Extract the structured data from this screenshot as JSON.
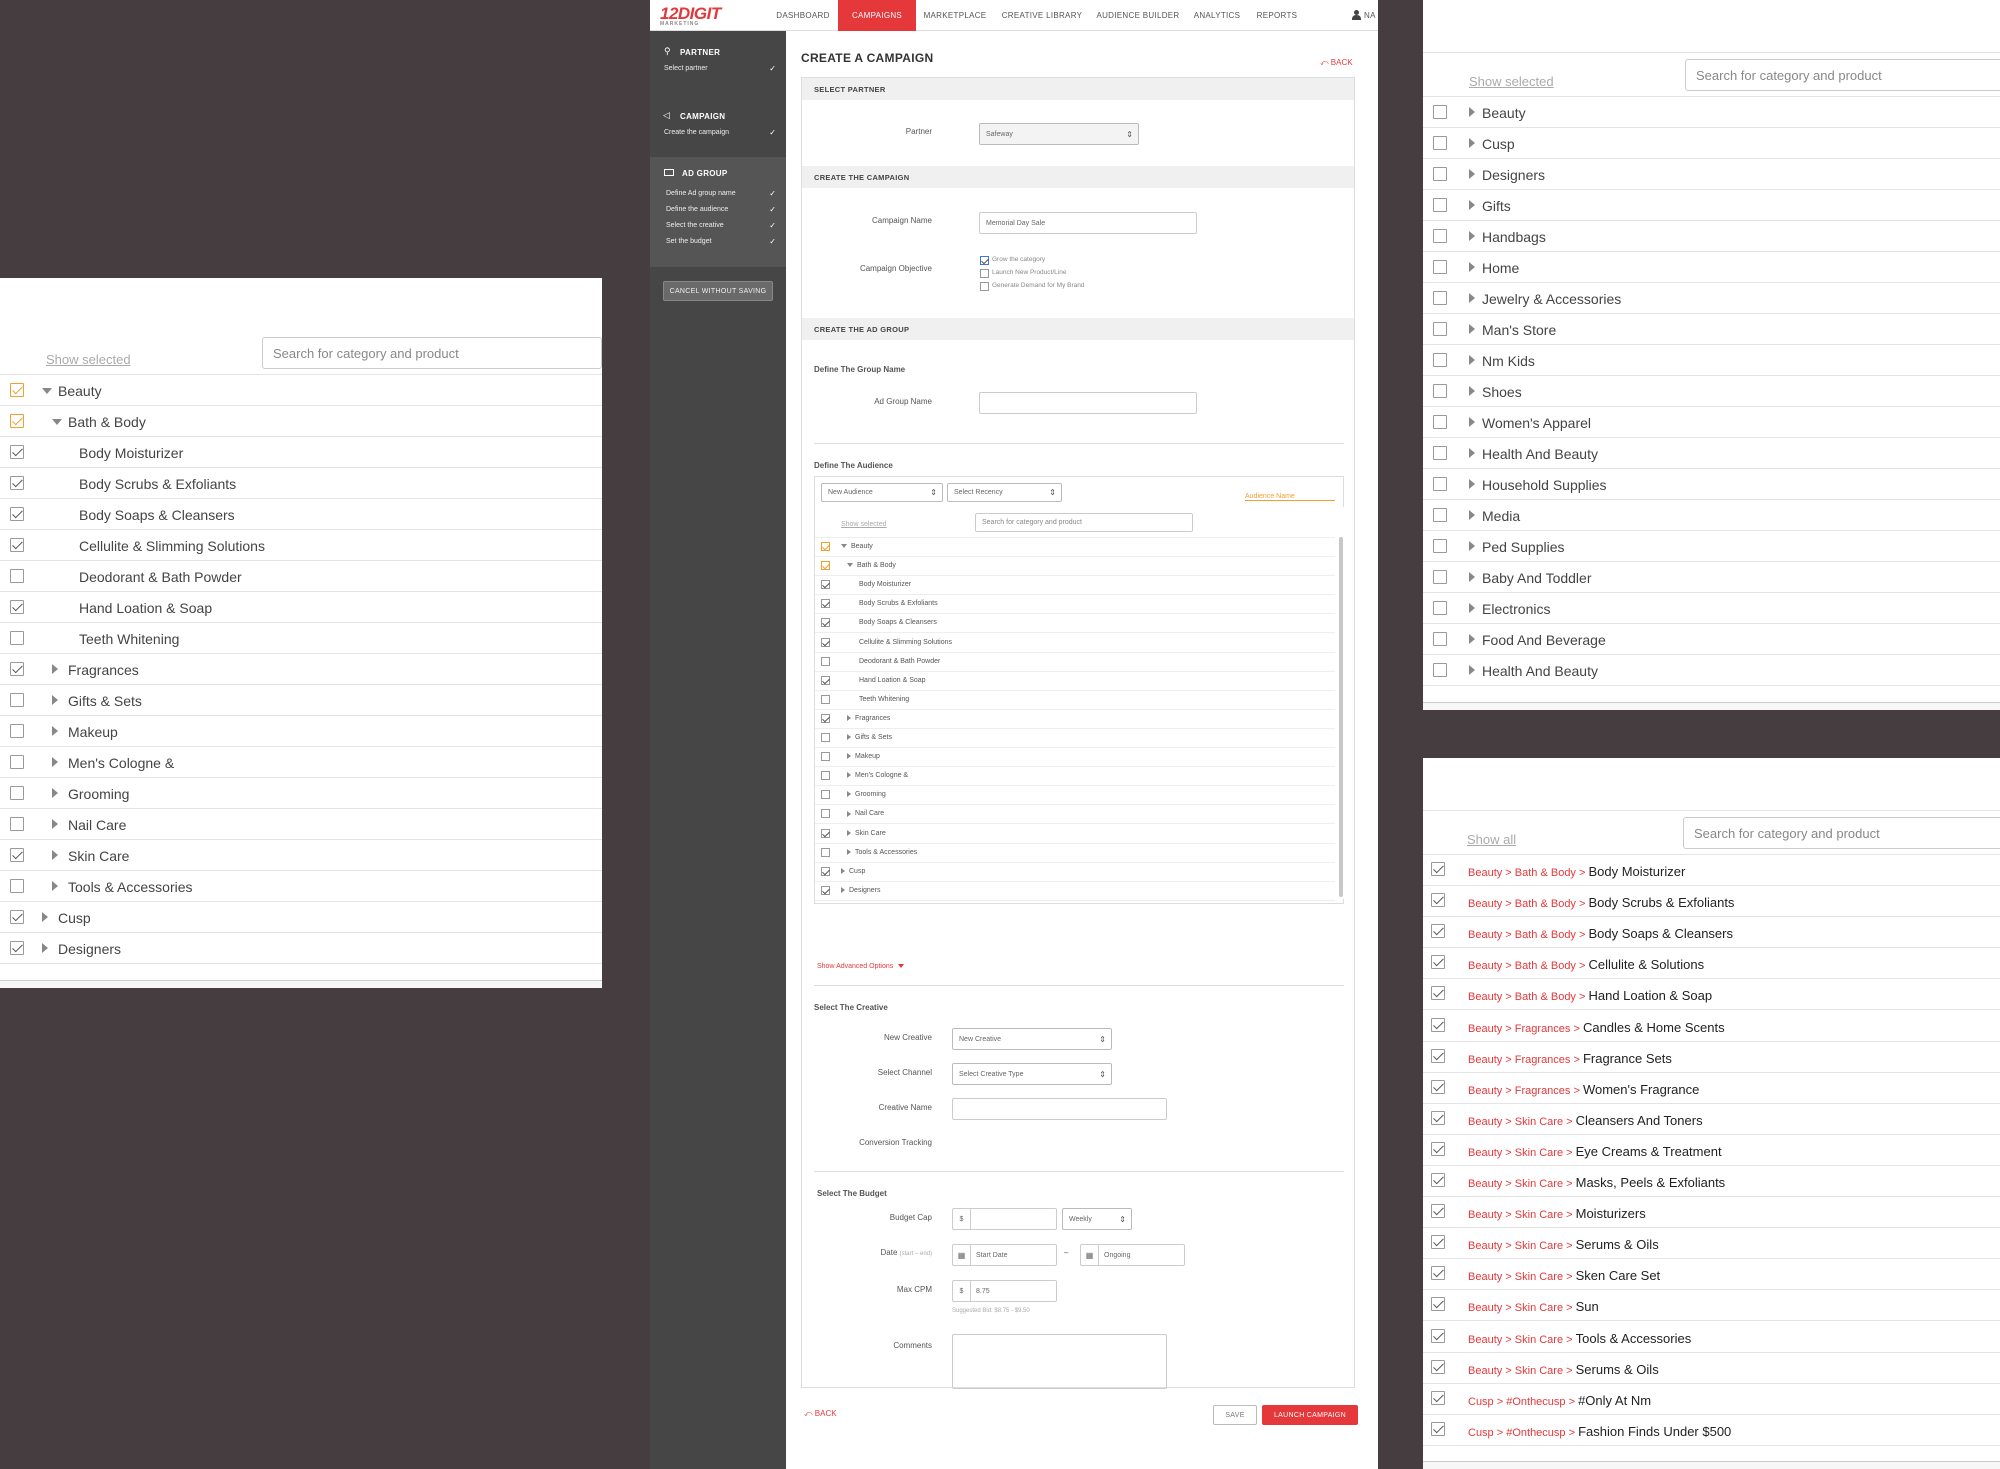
{
  "left_panel": {
    "show_link": "Show selected",
    "search_placeholder": "Search for category and product",
    "rows": [
      {
        "label": "Beauty",
        "level": 0,
        "expander": "down",
        "check": "orange"
      },
      {
        "label": "Bath & Body",
        "level": 1,
        "expander": "down",
        "check": "orange"
      },
      {
        "label": "Body Moisturizer",
        "level": 2,
        "expander": "none",
        "check": "on"
      },
      {
        "label": "Body Scrubs & Exfoliants",
        "level": 2,
        "expander": "none",
        "check": "on"
      },
      {
        "label": "Body Soaps & Cleansers",
        "level": 2,
        "expander": "none",
        "check": "on"
      },
      {
        "label": "Cellulite & Slimming Solutions",
        "level": 2,
        "expander": "none",
        "check": "on"
      },
      {
        "label": "Deodorant & Bath Powder",
        "level": 2,
        "expander": "none",
        "check": "off"
      },
      {
        "label": "Hand Loation & Soap",
        "level": 2,
        "expander": "none",
        "check": "on"
      },
      {
        "label": "Teeth Whitening",
        "level": 2,
        "expander": "none",
        "check": "off"
      },
      {
        "label": "Fragrances",
        "level": 1,
        "expander": "right",
        "check": "on"
      },
      {
        "label": "Gifts & Sets",
        "level": 1,
        "expander": "right",
        "check": "off"
      },
      {
        "label": "Makeup",
        "level": 1,
        "expander": "right",
        "check": "off"
      },
      {
        "label": "Men's Cologne &",
        "level": 1,
        "expander": "right",
        "check": "off"
      },
      {
        "label": "Grooming",
        "level": 1,
        "expander": "right",
        "check": "off"
      },
      {
        "label": "Nail Care",
        "level": 1,
        "expander": "right",
        "check": "off"
      },
      {
        "label": "Skin Care",
        "level": 1,
        "expander": "right",
        "check": "on"
      },
      {
        "label": "Tools & Accessories",
        "level": 1,
        "expander": "right",
        "check": "off"
      },
      {
        "label": "Cusp",
        "level": 0,
        "expander": "right",
        "check": "on"
      },
      {
        "label": "Designers",
        "level": 0,
        "expander": "right",
        "check": "on"
      }
    ]
  },
  "right_top_panel": {
    "show_link": "Show selected",
    "search_placeholder": "Search for category and product",
    "rows": [
      "Beauty",
      "Cusp",
      "Designers",
      "Gifts",
      "Handbags",
      "Home",
      "Jewelry & Accessories",
      "Man's Store",
      "Nm Kids",
      "Shoes",
      "Women's Apparel",
      "Health And Beauty",
      "Household Supplies",
      "Media",
      "Ped Supplies",
      "Baby And Toddler",
      "Electronics",
      "Food And Beverage",
      "Health And Beauty"
    ]
  },
  "right_bottom_panel": {
    "show_link": "Show all",
    "search_placeholder": "Search for category and product",
    "rows": [
      {
        "path": "Beauty > Bath & Body > ",
        "item": "Body Moisturizer"
      },
      {
        "path": "Beauty > Bath & Body > ",
        "item": "Body Scrubs & Exfoliants"
      },
      {
        "path": "Beauty > Bath & Body > ",
        "item": "Body Soaps & Cleansers"
      },
      {
        "path": "Beauty > Bath & Body > ",
        "item": "Cellulite & Solutions"
      },
      {
        "path": "Beauty > Bath & Body > ",
        "item": "Hand Loation & Soap"
      },
      {
        "path": "Beauty > Fragrances > ",
        "item": "Candles & Home Scents"
      },
      {
        "path": "Beauty > Fragrances > ",
        "item": "Fragrance Sets"
      },
      {
        "path": "Beauty > Fragrances > ",
        "item": "Women's Fragrance"
      },
      {
        "path": "Beauty > Skin Care > ",
        "item": "Cleansers And Toners"
      },
      {
        "path": "Beauty > Skin Care > ",
        "item": "Eye Creams & Treatment"
      },
      {
        "path": "Beauty > Skin Care > ",
        "item": "Masks, Peels & Exfoliants"
      },
      {
        "path": "Beauty > Skin Care > ",
        "item": "Moisturizers"
      },
      {
        "path": "Beauty > Skin Care > ",
        "item": "Serums & Oils"
      },
      {
        "path": "Beauty > Skin Care > ",
        "item": "Sken Care Set"
      },
      {
        "path": "Beauty > Skin Care > ",
        "item": "Sun"
      },
      {
        "path": "Beauty > Skin Care > ",
        "item": "Tools & Accessories"
      },
      {
        "path": "Beauty > Skin Care > ",
        "item": "Serums & Oils"
      },
      {
        "path": "Cusp > #Onthecusp > ",
        "item": "#Only At Nm"
      },
      {
        "path": "Cusp > #Onthecusp > ",
        "item": "Fashion Finds Under $500"
      }
    ]
  },
  "app": {
    "logo": "12DIGIT",
    "logo_sub": "MARKETING",
    "nav": [
      "DASHBOARD",
      "CAMPAIGNS",
      "MARKETPLACE",
      "CREATIVE LIBRARY",
      "AUDIENCE BUILDER",
      "ANALYTICS",
      "REPORTS"
    ],
    "user": "NA",
    "sidebar": {
      "partner": {
        "title": "PARTNER",
        "items": [
          "Select partner"
        ]
      },
      "campaign": {
        "title": "CAMPAIGN",
        "items": [
          "Create the campaign"
        ]
      },
      "ad_group": {
        "title": "AD GROUP",
        "items": [
          "Define Ad group name",
          "Define the audience",
          "Select the creative",
          "Set the budget"
        ]
      },
      "cancel": "CANCEL WITHOUT SAVING"
    },
    "page_title": "CREATE A CAMPAIGN",
    "back": "BACK",
    "select_partner": {
      "header": "SELECT PARTNER",
      "label": "Partner",
      "value": "Safeway"
    },
    "create_campaign": {
      "header": "CREATE THE CAMPAIGN",
      "name_label": "Campaign Name",
      "name_value": "Memorial Day Sale",
      "objective_label": "Campaign Objective",
      "objectives": [
        "Grow the category",
        "Launch New Product/Line",
        "Generate Demand for My Brand"
      ]
    },
    "ad_group": {
      "header": "CREATE THE AD GROUP",
      "group_name_title": "Define The Group Name",
      "group_name_label": "Ad Group Name",
      "audience_title": "Define The Audience",
      "new_audience": "New Audience",
      "recency": "Select Recency",
      "audience_name": "Audience Name",
      "show_selected": "Show selected",
      "search_placeholder": "Search for category and product",
      "tree": [
        {
          "label": "Beauty",
          "level": 0,
          "expander": "down",
          "check": "orange"
        },
        {
          "label": "Bath & Body",
          "level": 1,
          "expander": "down",
          "check": "orange"
        },
        {
          "label": "Body Moisturizer",
          "level": 2,
          "expander": "none",
          "check": "on"
        },
        {
          "label": "Body Scrubs & Exfoliants",
          "level": 2,
          "expander": "none",
          "check": "on"
        },
        {
          "label": "Body Soaps & Cleansers",
          "level": 2,
          "expander": "none",
          "check": "on"
        },
        {
          "label": "Cellulite & Slimming Solutions",
          "level": 2,
          "expander": "none",
          "check": "on"
        },
        {
          "label": "Deodorant & Bath Powder",
          "level": 2,
          "expander": "none",
          "check": "off"
        },
        {
          "label": "Hand Loation & Soap",
          "level": 2,
          "expander": "none",
          "check": "on"
        },
        {
          "label": "Teeth Whitening",
          "level": 2,
          "expander": "none",
          "check": "off"
        },
        {
          "label": "Fragrances",
          "level": 1,
          "expander": "right",
          "check": "on"
        },
        {
          "label": "Gifts & Sets",
          "level": 1,
          "expander": "right",
          "check": "off"
        },
        {
          "label": "Makeup",
          "level": 1,
          "expander": "right",
          "check": "off"
        },
        {
          "label": "Men's Cologne &",
          "level": 1,
          "expander": "right",
          "check": "off"
        },
        {
          "label": "Grooming",
          "level": 1,
          "expander": "right",
          "check": "off"
        },
        {
          "label": "Nail Care",
          "level": 1,
          "expander": "right",
          "check": "off"
        },
        {
          "label": "Skin Care",
          "level": 1,
          "expander": "right",
          "check": "on"
        },
        {
          "label": "Tools & Accessories",
          "level": 1,
          "expander": "right",
          "check": "off"
        },
        {
          "label": "Cusp",
          "level": 0,
          "expander": "right",
          "check": "on"
        },
        {
          "label": "Designers",
          "level": 0,
          "expander": "right",
          "check": "on"
        }
      ],
      "advanced": "Show Advanced Options",
      "creative_title": "Select The Creative",
      "new_creative_label": "New Creative",
      "new_creative_value": "New Creative",
      "channel_label": "Select Channel",
      "channel_value": "Select Creative Type",
      "creative_name_label": "Creative Name",
      "conversion_label": "Conversion Tracking",
      "budget_title": "Select The Budget",
      "budget_cap_label": "Budget Cap",
      "currency": "$",
      "period": "Weekly",
      "date_label": "Date",
      "date_hint": "(start – end)",
      "start_date": "Start Date",
      "date_sep": "–",
      "end_date": "Ongoing",
      "max_cpm_label": "Max CPM",
      "max_cpm_value": "8.75",
      "suggested": "Suggested Bid: $8.75 - $9.50",
      "comments_label": "Comments"
    },
    "footer": {
      "back": "BACK",
      "save": "SAVE",
      "launch": "LAUNCH CAMPAIGN"
    }
  },
  "colors": {
    "accent": "#e5383b",
    "checkbox_partial": "#f0a030",
    "sidebar": "#464646",
    "backdrop": "#463d41"
  }
}
